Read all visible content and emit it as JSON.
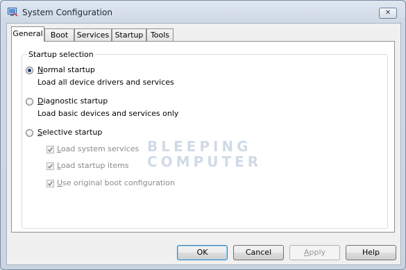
{
  "window": {
    "title": "System Configuration",
    "close_glyph": "✕"
  },
  "tabs": [
    {
      "label": "General",
      "active": true
    },
    {
      "label": "Boot",
      "active": false
    },
    {
      "label": "Services",
      "active": false
    },
    {
      "label": "Startup",
      "active": false
    },
    {
      "label": "Tools",
      "active": false
    }
  ],
  "startup": {
    "group_label": "Startup selection",
    "selected": "normal",
    "normal": {
      "mnemonic": "N",
      "label_rest": "ormal startup",
      "desc": "Load all device drivers and services"
    },
    "diagnostic": {
      "mnemonic": "D",
      "label_rest": "iagnostic startup",
      "desc": "Load basic devices and services only"
    },
    "selective": {
      "mnemonic": "S",
      "label_rest": "elective startup"
    },
    "options": [
      {
        "mnemonic": "L",
        "label_rest": "oad system services",
        "checked": true,
        "enabled": false
      },
      {
        "mnemonic": "L",
        "label_rest": "oad startup items",
        "checked": true,
        "enabled": false
      },
      {
        "mnemonic": "U",
        "label_rest": "se original boot configuration",
        "checked": true,
        "enabled": false
      }
    ]
  },
  "watermark": {
    "line1": "BLEEPING",
    "line2": "COMPUTER"
  },
  "buttons": {
    "ok": "OK",
    "cancel": "Cancel",
    "apply_mnemonic": "A",
    "apply_rest": "pply",
    "apply_enabled": false,
    "help": "Help"
  },
  "colors": {
    "selected_radio": "#1c3c70",
    "disabled_text": "#8a8a8a",
    "window_frame": "#7a8ba0"
  }
}
